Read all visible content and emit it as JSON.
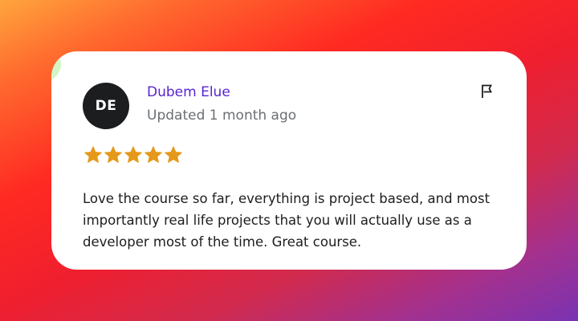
{
  "review": {
    "avatar_initials": "DE",
    "reviewer_name": "Dubem Elue",
    "updated_text": "Updated 1 month ago",
    "rating": 5,
    "rating_max": 5,
    "text": "Love the course so far, everything is project based, and most importantly real life projects that you will actually use as a developer most of the time. Great course."
  },
  "icons": {
    "report": "flag-icon",
    "rating": "star-icon"
  },
  "colors": {
    "name": "#5624d0",
    "meta": "#6a6f73",
    "star": "#e59819",
    "avatar_bg": "#1c1d1f",
    "text": "#1c1d1f"
  }
}
